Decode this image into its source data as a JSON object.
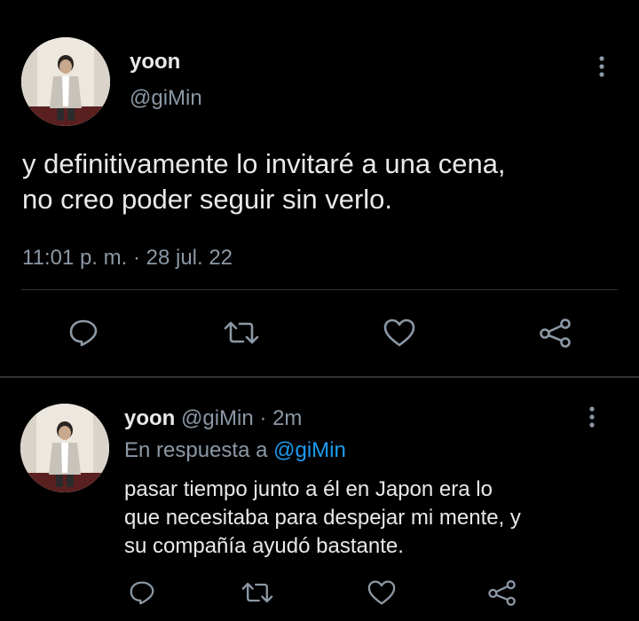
{
  "main_tweet": {
    "display_name": "yoon",
    "handle": "@giMin",
    "text_line1": "y definitivamente lo invitaré a una cena,",
    "text_line2": "no creo poder seguir sin verlo.",
    "timestamp": "11:01 p. m. · 28 jul. 22"
  },
  "reply_tweet": {
    "display_name": "yoon",
    "handle": "@giMin",
    "separator": "·",
    "time_ago": "2m",
    "replying_prefix": "En respuesta a",
    "replying_to": "@giMin",
    "text_line1": "pasar tiempo junto a él en Japon era lo",
    "text_line2": "que necesitaba para despejar mi mente, y",
    "text_line3": "su compañía ayudó bastante."
  },
  "icons": {
    "more": "more-vertical-icon",
    "reply": "reply-icon",
    "retweet": "retweet-icon",
    "like": "like-icon",
    "share": "share-icon"
  },
  "colors": {
    "background": "#000000",
    "text": "#e7e9ea",
    "secondary": "#8b98a5",
    "link": "#1d9bf0",
    "divider": "#2f3336"
  }
}
